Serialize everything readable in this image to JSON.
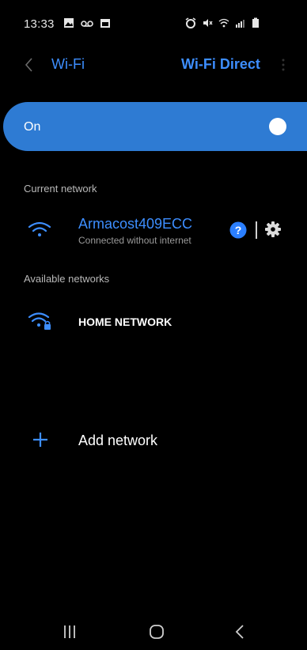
{
  "status_bar": {
    "time": "13:33",
    "left_icons": [
      "gallery-icon",
      "voicemail-icon",
      "calendar-icon"
    ],
    "right_icons": [
      "alarm-icon",
      "mute-icon",
      "wifi-icon",
      "signal-icon",
      "battery-icon"
    ]
  },
  "header": {
    "title": "Wi-Fi",
    "action": "Wi-Fi Direct"
  },
  "toggle": {
    "label": "On",
    "state": true
  },
  "current_network": {
    "heading": "Current network",
    "name": "Armacost409ECC",
    "status": "Connected without internet"
  },
  "available_networks": {
    "heading": "Available networks",
    "items": [
      {
        "name": "HOME NETWORK",
        "locked": true
      }
    ]
  },
  "add_network": {
    "label": "Add network"
  },
  "colors": {
    "accent": "#3d8eff",
    "toggle_bg": "#2e7bd3",
    "background": "#000000"
  }
}
